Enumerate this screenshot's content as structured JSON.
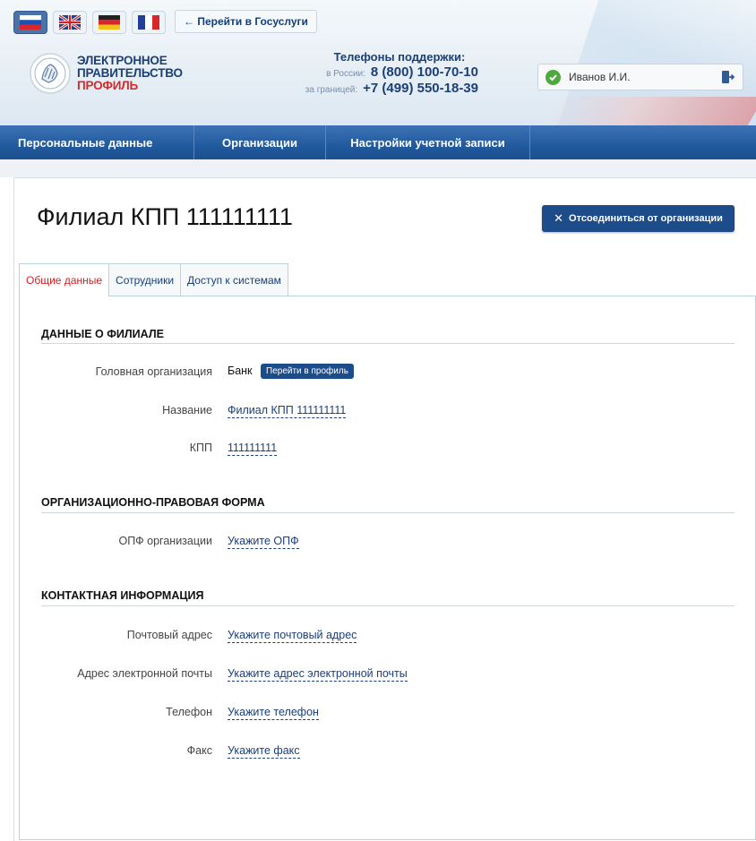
{
  "header": {
    "languages": [
      {
        "name": "ru-flag-icon",
        "active": true
      },
      {
        "name": "en-flag-icon",
        "active": false
      },
      {
        "name": "de-flag-icon",
        "active": false
      },
      {
        "name": "fr-flag-icon",
        "active": false
      }
    ],
    "gosuslugi_link": "← Перейти в Госуслуги",
    "logo": {
      "line1": "ЭЛЕКТРОННОЕ",
      "line2": "ПРАВИТЕЛЬСТВО",
      "line3": "ПРОФИЛЬ"
    },
    "support": {
      "title": "Телефоны поддержки:",
      "russia_label": "в России:",
      "russia_phone": "8 (800) 100-70-10",
      "abroad_label": "за границей:",
      "abroad_phone": "+7 (499) 550-18-39"
    },
    "user": {
      "name": "Иванов И.И."
    }
  },
  "nav": {
    "items": [
      "Персональные данные",
      "Организации",
      "Настройки учетной записи"
    ]
  },
  "page": {
    "title": "Филиал КПП 111111111",
    "disconnect_button": "Отсоединиться от организации"
  },
  "tabs": [
    "Общие данные",
    "Сотрудники",
    "Доступ к системам"
  ],
  "sections": {
    "branch": {
      "title": "ДАННЫЕ О ФИЛИАЛЕ",
      "head_org_label": "Головная организация",
      "head_org_value": "Банк",
      "profile_button": "Перейти в профиль",
      "name_label": "Название",
      "name_value": "Филиал КПП 111111111",
      "kpp_label": "КПП",
      "kpp_value": "111111111"
    },
    "legal_form": {
      "title": "ОРГАНИЗАЦИОННО-ПРАВОВАЯ ФОРМА",
      "opf_label": "ОПФ организации",
      "opf_value": "Укажите ОПФ"
    },
    "contacts": {
      "title": "КОНТАКТНАЯ ИНФОРМАЦИЯ",
      "postal_label": "Почтовый адрес",
      "postal_value": "Укажите почтовый адрес",
      "email_label": "Адрес электронной почты",
      "email_value": "Укажите адрес электронной почты",
      "phone_label": "Телефон",
      "phone_value": "Укажите телефон",
      "fax_label": "Факс",
      "fax_value": "Укажите факс"
    }
  },
  "colors": {
    "nav_blue": "#215a9e",
    "button_blue": "#1c4d8a",
    "active_tab_red": "#d32020",
    "link_blue": "#1b3f77",
    "check_green": "#4ea83f"
  }
}
